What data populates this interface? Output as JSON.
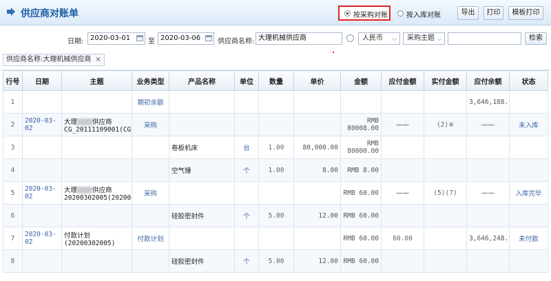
{
  "title": "供应商对账单",
  "modes": [
    {
      "label": "按采购对账",
      "selected": true
    },
    {
      "label": "按入库对账",
      "selected": false
    }
  ],
  "toolbar": {
    "export": "导出",
    "print": "打印",
    "template_print": "模板打印"
  },
  "filters": {
    "date_label": "日期:",
    "date_from": "2020-03-01",
    "to_label": "至",
    "date_to": "2020-03-06",
    "supplier_label": "供应商名称:",
    "supplier_value": "大理机械供应商",
    "currency": "人民币",
    "subject": "采购主题",
    "search_value": "",
    "search_button": "检索"
  },
  "chip": {
    "label": "供应商名称:大理机械供应商",
    "close": "×"
  },
  "columns": [
    "行号",
    "日期",
    "主题",
    "业务类型",
    "产品名称",
    "单位",
    "数量",
    "单价",
    "金额",
    "应付金额",
    "实付金额",
    "应付余额",
    "状态"
  ],
  "rows": [
    {
      "no": "1",
      "date": "",
      "subject": "",
      "type": "期初余额",
      "product": "",
      "unit": "",
      "qty": "",
      "price": "",
      "amount": "",
      "payable": "",
      "paid": "",
      "balance": "3,646,188.00",
      "status": ""
    },
    {
      "no": "2",
      "date": "2020-03-02",
      "subject_pre": "大理",
      "subject_post": "供应商CG_20111109001(CG_20111109001)",
      "type": "采购",
      "product": "",
      "unit": "",
      "qty": "",
      "price": "",
      "amount": "RMB 80008.00",
      "payable": "——",
      "paid": "(2)※",
      "balance": "——",
      "status": "未入库"
    },
    {
      "no": "3",
      "date": "",
      "subject": "",
      "type": "",
      "product": "卷板机床",
      "unit": "台",
      "qty": "1.00",
      "price": "80,000.00",
      "amount": "RMB 80000.00",
      "payable": "",
      "paid": "",
      "balance": "",
      "status": ""
    },
    {
      "no": "4",
      "date": "",
      "subject": "",
      "type": "",
      "product": "空气锤",
      "unit": "个",
      "qty": "1.00",
      "price": "8.00",
      "amount": "RMB 8.00",
      "payable": "",
      "paid": "",
      "balance": "",
      "status": ""
    },
    {
      "no": "5",
      "date": "2020-03-02",
      "subject_pre": "大理",
      "subject_post": "供应商20200302005(20200302005)",
      "type": "采购",
      "product": "",
      "unit": "",
      "qty": "",
      "price": "",
      "amount": "RMB 60.00",
      "payable": "——",
      "paid": "(5)(7)",
      "balance": "——",
      "status": "入库完毕"
    },
    {
      "no": "6",
      "date": "",
      "subject": "",
      "type": "",
      "product": "硅胶密封件",
      "unit": "个",
      "qty": "5.00",
      "price": "12.00",
      "amount": "RMB 60.00",
      "payable": "",
      "paid": "",
      "balance": "",
      "status": ""
    },
    {
      "no": "7",
      "date": "2020-03-02",
      "subject": "付款计划(20200302005)",
      "type": "付款计划",
      "product": "",
      "unit": "",
      "qty": "",
      "price": "",
      "amount": "RMB 60.00",
      "payable": "60.00",
      "paid": "",
      "balance": "3,646,248.00",
      "status": "未付款"
    },
    {
      "no": "8",
      "date": "",
      "subject": "",
      "type": "",
      "product": "硅胶密封件",
      "unit": "个",
      "qty": "5.00",
      "price": "12.00",
      "amount": "RMB 60.00",
      "payable": "",
      "paid": "",
      "balance": "",
      "status": ""
    }
  ],
  "colors": {
    "accent": "#1d5fa5",
    "highlight": "#e02424",
    "header_bg": "#dbe9f8"
  },
  "icons": {
    "title": "arrow-right-icon",
    "date": "calendar-icon",
    "link": "link-icon"
  }
}
